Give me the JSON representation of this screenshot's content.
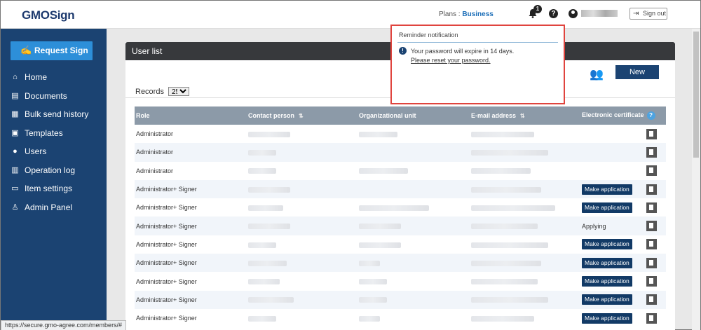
{
  "header": {
    "logo": "GMOSign",
    "plans_label": "Plans : ",
    "plan_name": "Business",
    "notification_count": "1",
    "help_glyph": "?",
    "signout_label": "Sign out"
  },
  "sidebar": {
    "request_label": "Request Sign",
    "items": [
      {
        "label": "Home",
        "icon": "home-icon"
      },
      {
        "label": "Documents",
        "icon": "documents-icon"
      },
      {
        "label": "Bulk send history",
        "icon": "bulk-send-icon"
      },
      {
        "label": "Templates",
        "icon": "templates-icon"
      },
      {
        "label": "Users",
        "icon": "users-icon"
      },
      {
        "label": "Operation log",
        "icon": "operation-log-icon"
      },
      {
        "label": "Item settings",
        "icon": "item-settings-icon"
      },
      {
        "label": "Admin Panel",
        "icon": "admin-panel-icon"
      }
    ]
  },
  "main": {
    "title": "User list",
    "new_label": "New",
    "records_label": "Records",
    "records_value": "25",
    "columns": [
      "Role",
      "Contact person",
      "Organizational unit",
      "E-mail address",
      "Electronic certificate"
    ],
    "rows": [
      {
        "role": "Administrator",
        "cert": ""
      },
      {
        "role": "Administrator",
        "cert": ""
      },
      {
        "role": "Administrator",
        "cert": ""
      },
      {
        "role": "Administrator+ Signer",
        "cert": "Make application"
      },
      {
        "role": "Administrator+ Signer",
        "cert": "Make application"
      },
      {
        "role": "Administrator+ Signer",
        "cert": "Applying"
      },
      {
        "role": "Administrator+ Signer",
        "cert": "Make application"
      },
      {
        "role": "Administrator+ Signer",
        "cert": "Make application"
      },
      {
        "role": "Administrator+ Signer",
        "cert": "Make application"
      },
      {
        "role": "Administrator+ Signer",
        "cert": "Make application"
      },
      {
        "role": "Administrator+ Signer",
        "cert": "Make application"
      }
    ]
  },
  "popup": {
    "title": "Reminder notification",
    "message": "Your password will expire in 14 days.",
    "link": "Please reset your password."
  },
  "statusbar": {
    "url": "https://secure.gmo-agree.com/members/#"
  },
  "colors": {
    "sidebar": "#1b4372",
    "accent": "#2d8fd9",
    "highlight_border": "#e0443e"
  }
}
